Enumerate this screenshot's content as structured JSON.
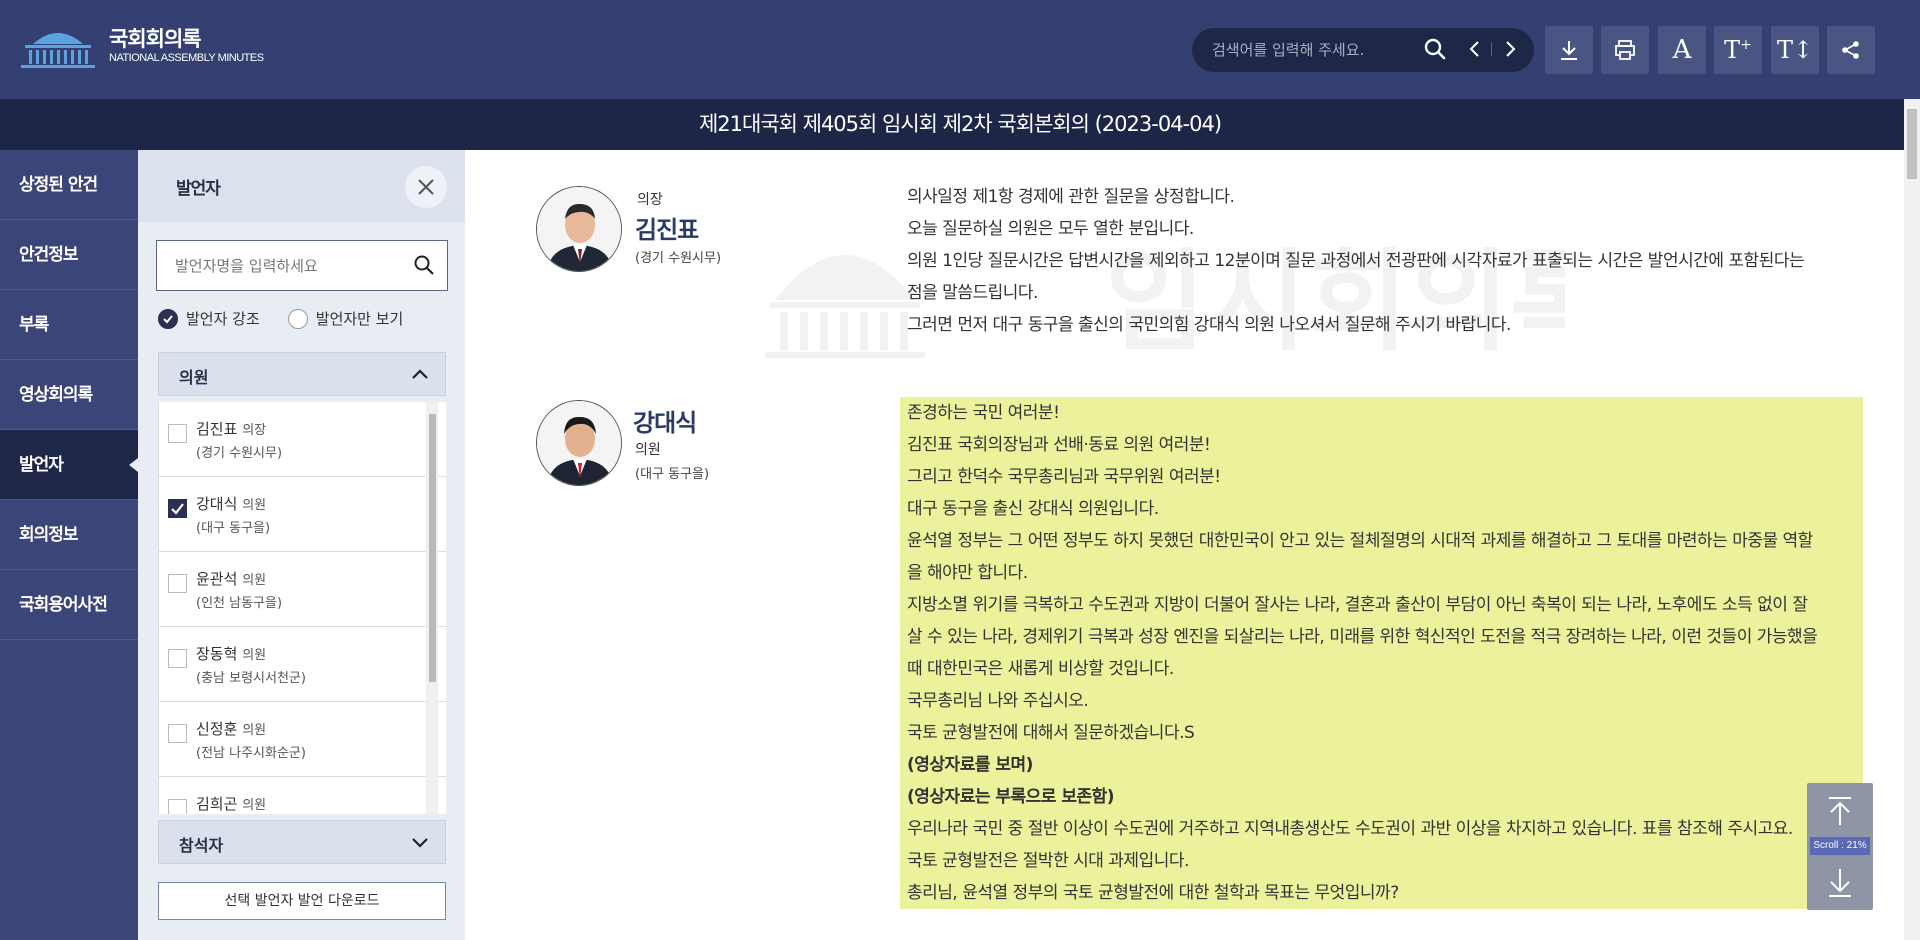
{
  "header": {
    "logo_title": "국회회의록",
    "logo_sub": "NATIONAL ASSEMBLY MINUTES",
    "search_placeholder": "검색어를 입력해 주세요.",
    "tools": [
      "download-icon",
      "print-icon",
      "font-icon",
      "font-increase-icon",
      "line-spacing-icon",
      "share-icon"
    ]
  },
  "title": "제21대국회 제405회 임시회 제2차 국회본회의 (2023-04-04)",
  "nav": {
    "items": [
      {
        "label": "상정된 안건"
      },
      {
        "label": "안건정보"
      },
      {
        "label": "부록"
      },
      {
        "label": "영상회의록"
      },
      {
        "label": "발언자"
      },
      {
        "label": "회의정보"
      },
      {
        "label": "국회용어사전"
      }
    ],
    "active": "발언자"
  },
  "panel": {
    "title": "발언자",
    "search_placeholder": "발언자명을 입력하세요",
    "radio_emphasize": "발언자 강조",
    "radio_only": "발언자만 보기",
    "group_members": "의원",
    "group_attendees": "참석자",
    "speakers": [
      {
        "name": "김진표",
        "role": "의장",
        "district": "(경기 수원시무)",
        "checked": false
      },
      {
        "name": "강대식",
        "role": "의원",
        "district": "(대구 동구을)",
        "checked": true
      },
      {
        "name": "윤관석",
        "role": "의원",
        "district": "(인천 남동구을)",
        "checked": false
      },
      {
        "name": "장동혁",
        "role": "의원",
        "district": "(충남 보령시서천군)",
        "checked": false
      },
      {
        "name": "신정훈",
        "role": "의원",
        "district": "(전남 나주시화순군)",
        "checked": false
      },
      {
        "name": "김희곤",
        "role": "의원",
        "district": "",
        "checked": false
      }
    ],
    "download_label": "선택 발언자 발언 다운로드"
  },
  "main": {
    "watermark": "임시회의록",
    "speech1": {
      "role": "의장",
      "name": "김진표",
      "district": "(경기 수원시무)",
      "lines": [
        "의사일정 제1항 경제에 관한 질문을 상정합니다.",
        "오늘 질문하실 의원은 모두 열한 분입니다.",
        "의원 1인당 질문시간은 답변시간을 제외하고 12분이며 질문 과정에서 전광판에 시각자료가 표출되는 시간은 발언시간에 포함된다는",
        "점을 말씀드립니다.",
        "그러면 먼저 대구 동구을 출신의 국민의힘 강대식 의원 나오셔서 질문해 주시기 바랍니다."
      ]
    },
    "speech2": {
      "name": "강대식",
      "role": "의원",
      "district": "(대구 동구을)",
      "lines": [
        "존경하는 국민 여러분!",
        "김진표 국회의장님과 선배·동료 의원 여러분!",
        "그리고 한덕수 국무총리님과 국무위원 여러분!",
        "대구 동구을 출신 강대식 의원입니다.",
        "윤석열 정부는 그 어떤 정부도 하지 못했던 대한민국이 안고 있는 절체절명의 시대적 과제를 해결하고 그 토대를 마련하는 마중물 역할",
        "을 해야만 합니다.",
        "지방소멸 위기를 극복하고 수도권과 지방이 더불어 잘사는 나라, 결혼과 출산이 부담이 아닌 축복이 되는 나라, 노후에도 소득 없이 잘",
        "살 수 있는 나라, 경제위기 극복과 성장 엔진을 되살리는 나라, 미래를 위한 혁신적인 도전을 적극 장려하는 나라, 이런 것들이 가능했을",
        "때 대한민국은 새롭게 비상할 것입니다.",
        "국무총리님 나와 주십시오.",
        "국토 균형발전에 대해서 질문하겠습니다.S",
        "(영상자료를 보며)",
        "(영상자료는 부록으로 보존함)",
        "우리나라 국민 중 절반 이상이 수도권에 거주하고 지역내총생산도 수도권이 과반 이상을 차지하고 있습니다. 표를 참조해 주시고요.",
        "국토 균형발전은 절박한 시대 과제입니다.",
        "총리님, 윤석열 정부의 국토 균형발전에 대한 철학과 목표는 무엇입니까?"
      ]
    }
  },
  "scroll_widget": {
    "label": "Scroll : 21%"
  }
}
